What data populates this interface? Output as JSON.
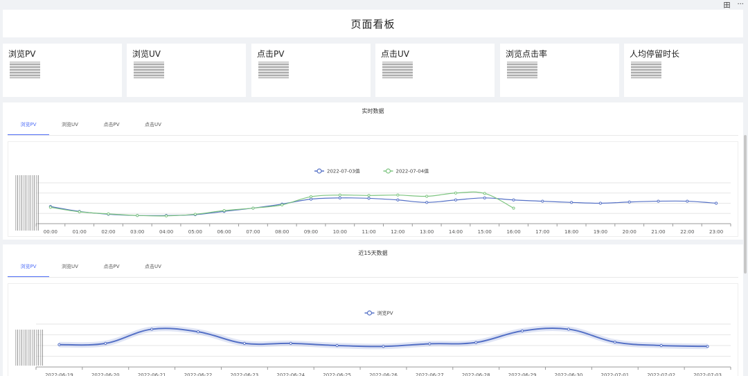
{
  "topbar": {
    "icons": [
      "grid-icon",
      "more-icon"
    ],
    "more_glyph": "···",
    "grid_glyph": "田"
  },
  "header": {
    "title": "页面看板"
  },
  "metrics": [
    {
      "label": "浏览PV"
    },
    {
      "label": "浏览UV"
    },
    {
      "label": "点击PV"
    },
    {
      "label": "点击UV"
    },
    {
      "label": "浏览点击率"
    },
    {
      "label": "人均停留时长"
    }
  ],
  "realtime": {
    "title": "实时数据",
    "tabs": [
      "浏览PV",
      "浏览UV",
      "点击PV",
      "点击UV"
    ],
    "active_tab": 0
  },
  "recent": {
    "title": "近15天数据",
    "tabs": [
      "浏览PV",
      "浏览UV",
      "点击PV",
      "点击UV"
    ],
    "active_tab": 0
  },
  "colors": {
    "blue": "#5470c6",
    "green": "#7cc47f",
    "accent": "#4f6ef7"
  },
  "chart_data": [
    {
      "type": "line",
      "title": "实时数据",
      "x": [
        "00:00",
        "01:00",
        "02:00",
        "03:00",
        "04:00",
        "05:00",
        "06:00",
        "07:00",
        "08:00",
        "09:00",
        "10:00",
        "11:00",
        "12:00",
        "13:00",
        "14:00",
        "15:00",
        "16:00",
        "17:00",
        "18:00",
        "19:00",
        "20:00",
        "21:00",
        "22:00",
        "23:00"
      ],
      "ylim": [
        0,
        100
      ],
      "grid": true,
      "legend_position": "top-center",
      "smooth": true,
      "series": [
        {
          "name": "2022-07-03值",
          "color": "#5470c6",
          "values": [
            42,
            30,
            23,
            20,
            20,
            22,
            30,
            38,
            48,
            60,
            63,
            62,
            58,
            52,
            58,
            63,
            58,
            55,
            52,
            50,
            53,
            55,
            55,
            50
          ]
        },
        {
          "name": "2022-07-04值",
          "color": "#7cc47f",
          "values": [
            40,
            29,
            24,
            20,
            19,
            23,
            32,
            38,
            46,
            66,
            70,
            69,
            70,
            67,
            75,
            74,
            38
          ]
        }
      ]
    },
    {
      "type": "area",
      "title": "近15天数据",
      "x": [
        "2022-06-19",
        "2022-06-20",
        "2022-06-21",
        "2022-06-22",
        "2022-06-23",
        "2022-06-24",
        "2022-06-25",
        "2022-06-26",
        "2022-06-27",
        "2022-06-28",
        "2022-06-29",
        "2022-06-30",
        "2022-07-01",
        "2022-07-02",
        "2022-07-03"
      ],
      "ylim": [
        0,
        100
      ],
      "grid": true,
      "legend_position": "top-center",
      "smooth": true,
      "series": [
        {
          "name": "浏览PV",
          "color": "#5470c6",
          "values": [
            52,
            55,
            88,
            82,
            55,
            55,
            50,
            48,
            54,
            57,
            84,
            88,
            58,
            50,
            48
          ]
        }
      ]
    }
  ]
}
